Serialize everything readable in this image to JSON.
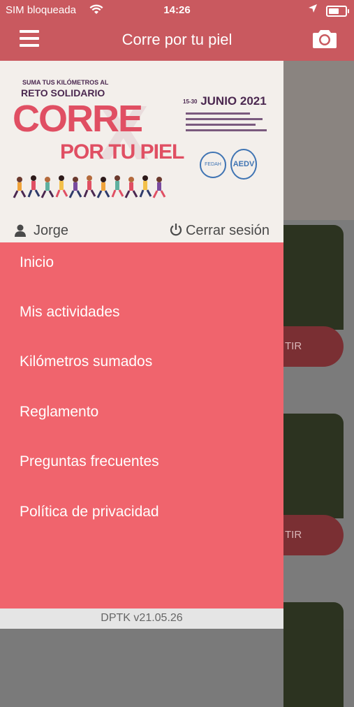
{
  "status": {
    "carrier": "SIM bloqueada",
    "time": "14:26"
  },
  "nav": {
    "title": "Corre por tu piel"
  },
  "hero": {
    "tagline_small": "SUMA TUS KILÓMETROS AL",
    "tagline_big": "RETO SOLIDARIO",
    "headline_1": "CORRE",
    "headline_2": "POR TU PIEL",
    "date_prefix": "15-30",
    "date": "JUNIO 2021",
    "logo_1": "FEDAH",
    "logo_2": "AEDV"
  },
  "user": {
    "name": "Jorge",
    "logout_label": "Cerrar sesión"
  },
  "menu": {
    "items": [
      {
        "label": "Inicio"
      },
      {
        "label": "Mis actividades"
      },
      {
        "label": "Kilómetros sumados"
      },
      {
        "label": "Reglamento"
      },
      {
        "label": "Preguntas frecuentes"
      },
      {
        "label": "Política de privacidad"
      }
    ]
  },
  "background": {
    "button_fragment_1": "TIR",
    "button_fragment_2": "TIR"
  },
  "footer": {
    "version": "DPTK v21.05.26"
  },
  "colors": {
    "bar": "#c9595f",
    "drawer": "#f0646d",
    "accent": "#e04f63"
  },
  "icons": [
    "wifi-icon",
    "location-arrow-icon",
    "battery-icon",
    "hamburger-icon",
    "camera-icon",
    "user-icon",
    "power-icon"
  ]
}
